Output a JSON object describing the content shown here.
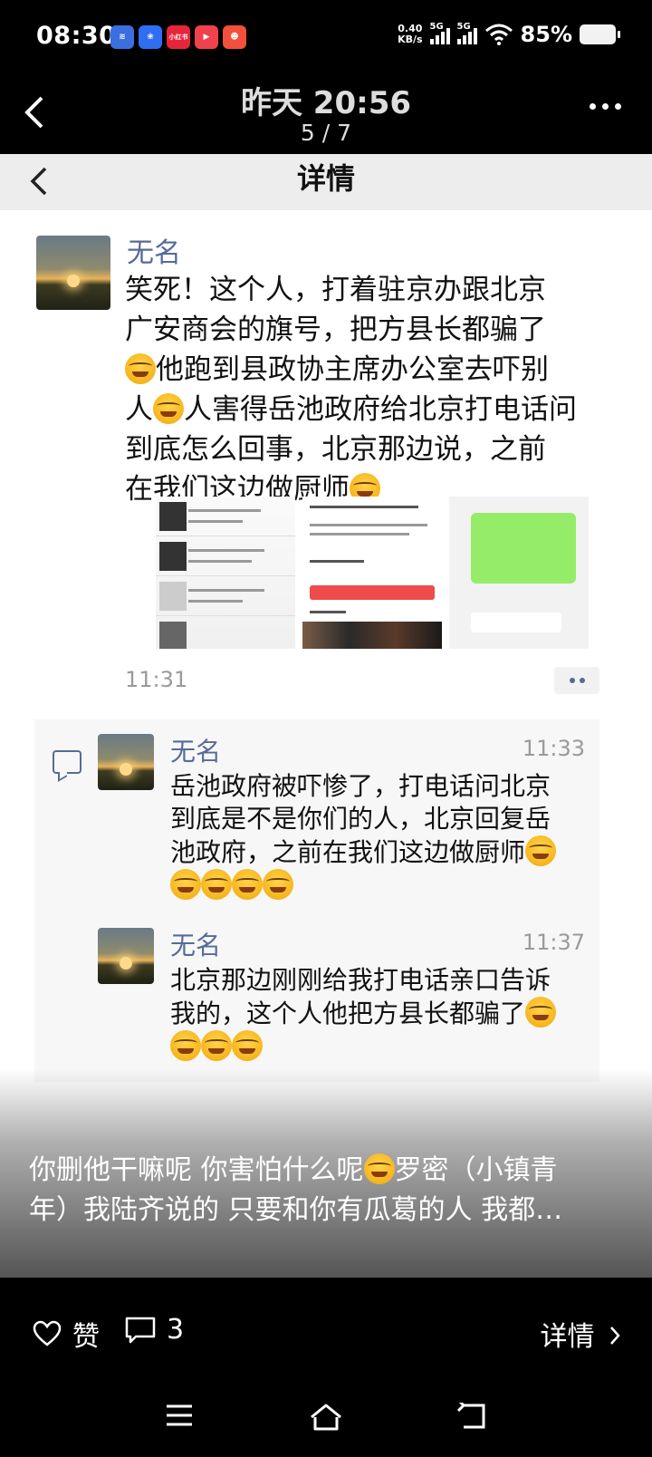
{
  "status_bar": {
    "time": "08:30",
    "net_speed_value": "0.40",
    "net_speed_unit": "KB/s",
    "signal1_label": "5G",
    "signal2_label": "5G",
    "battery": "85%",
    "app_icons": [
      "app-icon-1",
      "baidu-icon",
      "xiaohongshu-icon",
      "video-app-icon",
      "game-app-icon"
    ],
    "app_icon_label_3": "小红书"
  },
  "viewer_header": {
    "title": "昨天 20:56",
    "page_indicator": "5 / 7"
  },
  "screenshot": {
    "detail_title": "详情",
    "post": {
      "author": "无名",
      "text_lines": [
        "笑死！这个人，打着驻京办跟北京",
        "广安商会的旗号，把方县长都骗了",
        "他跑到县政协主席办公室去吓别",
        "人害得岳池政府给北京打电话问",
        "到底怎么回事，北京那边说，之前",
        "在我们这边做厨师"
      ],
      "time": "11:31"
    },
    "comments": [
      {
        "author": "无名",
        "time": "11:33",
        "lines": [
          "岳池政府被吓惨了，打电话问北京",
          "到底是不是你们的人，北京回复岳",
          "池政府，之前在我们这边做厨师"
        ]
      },
      {
        "author": "无名",
        "time": "11:37",
        "lines": [
          "北京那边刚刚给我打电话亲口告诉",
          "我的，这个人他把方县长都骗了"
        ]
      }
    ]
  },
  "caption": {
    "line1_a": "你删他干嘛呢 你害怕什么呢",
    "line1_b": "罗密（小镇青",
    "line2": "年）我陆齐说的 只要和你有瓜葛的人 我都…"
  },
  "actions": {
    "like_label": "赞",
    "comment_count": "3",
    "detail_label": "详情"
  },
  "colors": {
    "name_blue": "#566b95",
    "background_black": "#000000",
    "comment_bg": "#f7f7f7"
  }
}
